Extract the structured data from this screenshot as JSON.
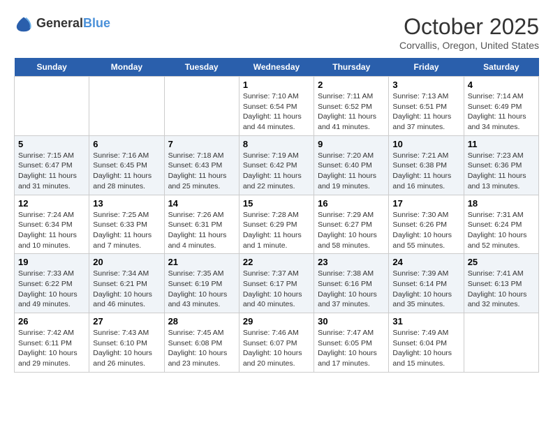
{
  "logo": {
    "general": "General",
    "blue": "Blue"
  },
  "title": "October 2025",
  "location": "Corvallis, Oregon, United States",
  "days_of_week": [
    "Sunday",
    "Monday",
    "Tuesday",
    "Wednesday",
    "Thursday",
    "Friday",
    "Saturday"
  ],
  "weeks": [
    [
      {
        "day": "",
        "sunrise": "",
        "sunset": "",
        "daylight": ""
      },
      {
        "day": "",
        "sunrise": "",
        "sunset": "",
        "daylight": ""
      },
      {
        "day": "",
        "sunrise": "",
        "sunset": "",
        "daylight": ""
      },
      {
        "day": "1",
        "sunrise": "Sunrise: 7:10 AM",
        "sunset": "Sunset: 6:54 PM",
        "daylight": "Daylight: 11 hours and 44 minutes."
      },
      {
        "day": "2",
        "sunrise": "Sunrise: 7:11 AM",
        "sunset": "Sunset: 6:52 PM",
        "daylight": "Daylight: 11 hours and 41 minutes."
      },
      {
        "day": "3",
        "sunrise": "Sunrise: 7:13 AM",
        "sunset": "Sunset: 6:51 PM",
        "daylight": "Daylight: 11 hours and 37 minutes."
      },
      {
        "day": "4",
        "sunrise": "Sunrise: 7:14 AM",
        "sunset": "Sunset: 6:49 PM",
        "daylight": "Daylight: 11 hours and 34 minutes."
      }
    ],
    [
      {
        "day": "5",
        "sunrise": "Sunrise: 7:15 AM",
        "sunset": "Sunset: 6:47 PM",
        "daylight": "Daylight: 11 hours and 31 minutes."
      },
      {
        "day": "6",
        "sunrise": "Sunrise: 7:16 AM",
        "sunset": "Sunset: 6:45 PM",
        "daylight": "Daylight: 11 hours and 28 minutes."
      },
      {
        "day": "7",
        "sunrise": "Sunrise: 7:18 AM",
        "sunset": "Sunset: 6:43 PM",
        "daylight": "Daylight: 11 hours and 25 minutes."
      },
      {
        "day": "8",
        "sunrise": "Sunrise: 7:19 AM",
        "sunset": "Sunset: 6:42 PM",
        "daylight": "Daylight: 11 hours and 22 minutes."
      },
      {
        "day": "9",
        "sunrise": "Sunrise: 7:20 AM",
        "sunset": "Sunset: 6:40 PM",
        "daylight": "Daylight: 11 hours and 19 minutes."
      },
      {
        "day": "10",
        "sunrise": "Sunrise: 7:21 AM",
        "sunset": "Sunset: 6:38 PM",
        "daylight": "Daylight: 11 hours and 16 minutes."
      },
      {
        "day": "11",
        "sunrise": "Sunrise: 7:23 AM",
        "sunset": "Sunset: 6:36 PM",
        "daylight": "Daylight: 11 hours and 13 minutes."
      }
    ],
    [
      {
        "day": "12",
        "sunrise": "Sunrise: 7:24 AM",
        "sunset": "Sunset: 6:34 PM",
        "daylight": "Daylight: 11 hours and 10 minutes."
      },
      {
        "day": "13",
        "sunrise": "Sunrise: 7:25 AM",
        "sunset": "Sunset: 6:33 PM",
        "daylight": "Daylight: 11 hours and 7 minutes."
      },
      {
        "day": "14",
        "sunrise": "Sunrise: 7:26 AM",
        "sunset": "Sunset: 6:31 PM",
        "daylight": "Daylight: 11 hours and 4 minutes."
      },
      {
        "day": "15",
        "sunrise": "Sunrise: 7:28 AM",
        "sunset": "Sunset: 6:29 PM",
        "daylight": "Daylight: 11 hours and 1 minute."
      },
      {
        "day": "16",
        "sunrise": "Sunrise: 7:29 AM",
        "sunset": "Sunset: 6:27 PM",
        "daylight": "Daylight: 10 hours and 58 minutes."
      },
      {
        "day": "17",
        "sunrise": "Sunrise: 7:30 AM",
        "sunset": "Sunset: 6:26 PM",
        "daylight": "Daylight: 10 hours and 55 minutes."
      },
      {
        "day": "18",
        "sunrise": "Sunrise: 7:31 AM",
        "sunset": "Sunset: 6:24 PM",
        "daylight": "Daylight: 10 hours and 52 minutes."
      }
    ],
    [
      {
        "day": "19",
        "sunrise": "Sunrise: 7:33 AM",
        "sunset": "Sunset: 6:22 PM",
        "daylight": "Daylight: 10 hours and 49 minutes."
      },
      {
        "day": "20",
        "sunrise": "Sunrise: 7:34 AM",
        "sunset": "Sunset: 6:21 PM",
        "daylight": "Daylight: 10 hours and 46 minutes."
      },
      {
        "day": "21",
        "sunrise": "Sunrise: 7:35 AM",
        "sunset": "Sunset: 6:19 PM",
        "daylight": "Daylight: 10 hours and 43 minutes."
      },
      {
        "day": "22",
        "sunrise": "Sunrise: 7:37 AM",
        "sunset": "Sunset: 6:17 PM",
        "daylight": "Daylight: 10 hours and 40 minutes."
      },
      {
        "day": "23",
        "sunrise": "Sunrise: 7:38 AM",
        "sunset": "Sunset: 6:16 PM",
        "daylight": "Daylight: 10 hours and 37 minutes."
      },
      {
        "day": "24",
        "sunrise": "Sunrise: 7:39 AM",
        "sunset": "Sunset: 6:14 PM",
        "daylight": "Daylight: 10 hours and 35 minutes."
      },
      {
        "day": "25",
        "sunrise": "Sunrise: 7:41 AM",
        "sunset": "Sunset: 6:13 PM",
        "daylight": "Daylight: 10 hours and 32 minutes."
      }
    ],
    [
      {
        "day": "26",
        "sunrise": "Sunrise: 7:42 AM",
        "sunset": "Sunset: 6:11 PM",
        "daylight": "Daylight: 10 hours and 29 minutes."
      },
      {
        "day": "27",
        "sunrise": "Sunrise: 7:43 AM",
        "sunset": "Sunset: 6:10 PM",
        "daylight": "Daylight: 10 hours and 26 minutes."
      },
      {
        "day": "28",
        "sunrise": "Sunrise: 7:45 AM",
        "sunset": "Sunset: 6:08 PM",
        "daylight": "Daylight: 10 hours and 23 minutes."
      },
      {
        "day": "29",
        "sunrise": "Sunrise: 7:46 AM",
        "sunset": "Sunset: 6:07 PM",
        "daylight": "Daylight: 10 hours and 20 minutes."
      },
      {
        "day": "30",
        "sunrise": "Sunrise: 7:47 AM",
        "sunset": "Sunset: 6:05 PM",
        "daylight": "Daylight: 10 hours and 17 minutes."
      },
      {
        "day": "31",
        "sunrise": "Sunrise: 7:49 AM",
        "sunset": "Sunset: 6:04 PM",
        "daylight": "Daylight: 10 hours and 15 minutes."
      },
      {
        "day": "",
        "sunrise": "",
        "sunset": "",
        "daylight": ""
      }
    ]
  ]
}
